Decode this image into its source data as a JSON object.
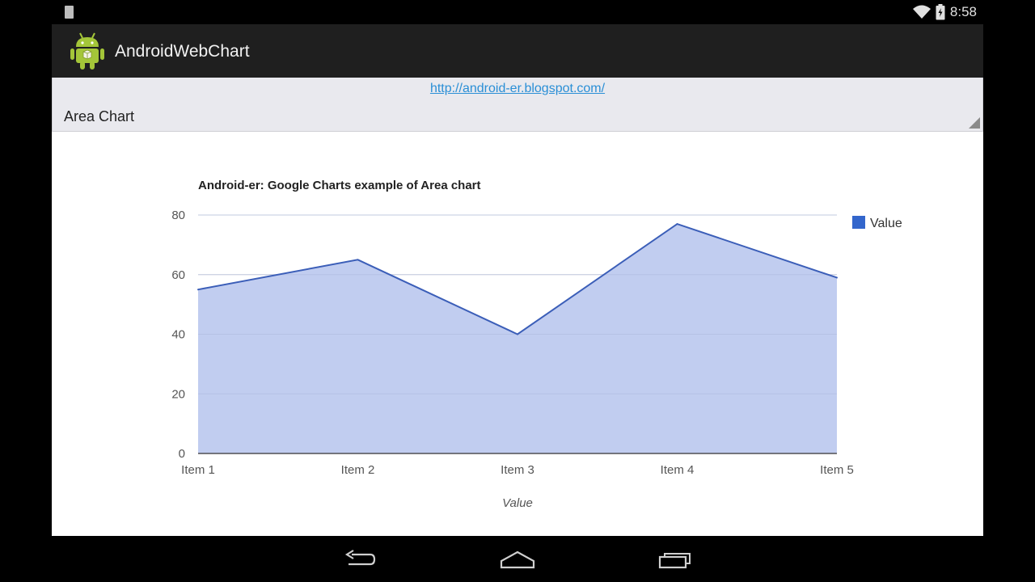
{
  "status_bar": {
    "time": "8:58"
  },
  "app": {
    "title": "AndroidWebChart"
  },
  "web": {
    "link": "http://android-er.blogspot.com/"
  },
  "spinner": {
    "selected": "Area Chart"
  },
  "chart_data": {
    "type": "area",
    "title": "Android-er: Google Charts example of Area chart",
    "categories": [
      "Item 1",
      "Item 2",
      "Item 3",
      "Item 4",
      "Item 5"
    ],
    "series": [
      {
        "name": "Value",
        "values": [
          55,
          65,
          40,
          77,
          59
        ]
      }
    ],
    "xlabel": "Value",
    "ylabel": "",
    "ylim": [
      0,
      80
    ],
    "yticks": [
      0,
      20,
      40,
      60,
      80
    ],
    "grid": true,
    "legend": "right",
    "colors": {
      "line": "#3b5eb8",
      "fill": "#c1cdf0",
      "legend_swatch": "#3366cc",
      "grid": "#e2e2e2"
    }
  },
  "icons": {
    "status_left": "notification-icon",
    "wifi": "wifi-icon",
    "battery": "battery-icon",
    "back": "back-icon",
    "home": "home-icon",
    "recents": "recents-icon"
  }
}
